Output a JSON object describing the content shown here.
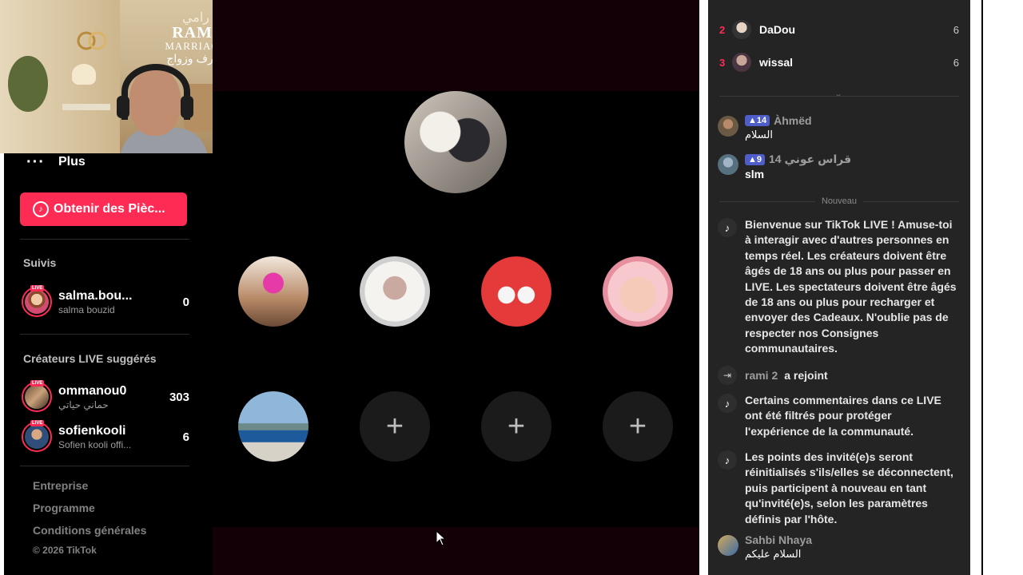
{
  "sidebar": {
    "more_label": "Plus",
    "more_icon": "more-dots-icon",
    "coins_button": "Obtenir des Pièc...",
    "following_title": "Suivis",
    "following": [
      {
        "name": "salma.bou...",
        "sub": "salma bouzid",
        "count": "0"
      }
    ],
    "suggested_title": "Créateurs LIVE suggérés",
    "suggested": [
      {
        "name": "ommanou0",
        "sub": "حماني حياتي",
        "count": "303",
        "live_badge": "LIVE"
      },
      {
        "name": "sofienkooli",
        "sub": "Sofien kooli offi...",
        "count": "6",
        "live_badge": "LIVE"
      }
    ],
    "footer": {
      "links": [
        "Entreprise",
        "Programme",
        "Conditions générales"
      ],
      "copyright": "© 2026 TikTok"
    }
  },
  "webcam": {
    "brand_arabic_top": "رامي",
    "brand_line1": "RAMI",
    "brand_line2": "MARRIAGE",
    "brand_arabic_bottom": "تعارف وزواج"
  },
  "stage": {
    "add_guest_icon": "+"
  },
  "chat": {
    "ranking": [
      {
        "rank": "2",
        "name": "DaDou",
        "score": "6"
      },
      {
        "rank": "3",
        "name": "wissal",
        "score": "6"
      }
    ],
    "messages_top": [
      {
        "badge": "14",
        "name": "Àhmëd",
        "text": "السلام"
      },
      {
        "badge": "9",
        "name": "قراس عوني 14",
        "text": "slm"
      }
    ],
    "new_label": "Nouveau",
    "system": [
      "Bienvenue sur TikTok LIVE ! Amuse-toi à interagir avec d'autres personnes en temps réel. Les créateurs doivent être âgés de 18 ans ou plus pour passer en LIVE. Les spectateurs doivent être âgés de 18 ans ou plus pour recharger et envoyer des Cadeaux. N'oublie pas de respecter nos Consignes communautaires.",
      "Certains commentaires dans ce LIVE ont été filtrés pour protéger l'expérience de la communauté.",
      "Les points des invité(e)s seront réinitialisés s'ils/elles se déconnectent, puis participent à nouveau en tant qu'invité(e)s, selon les paramètres définis par l'hôte."
    ],
    "join": {
      "name": "rami 2",
      "action": "a rejoint"
    },
    "last_message": {
      "name": "Sahbi Nhaya",
      "text": "السلام عليكم"
    }
  },
  "colors": {
    "accent": "#fe2c55",
    "chat_bg": "#242424",
    "badge": "#4e5dc8"
  }
}
